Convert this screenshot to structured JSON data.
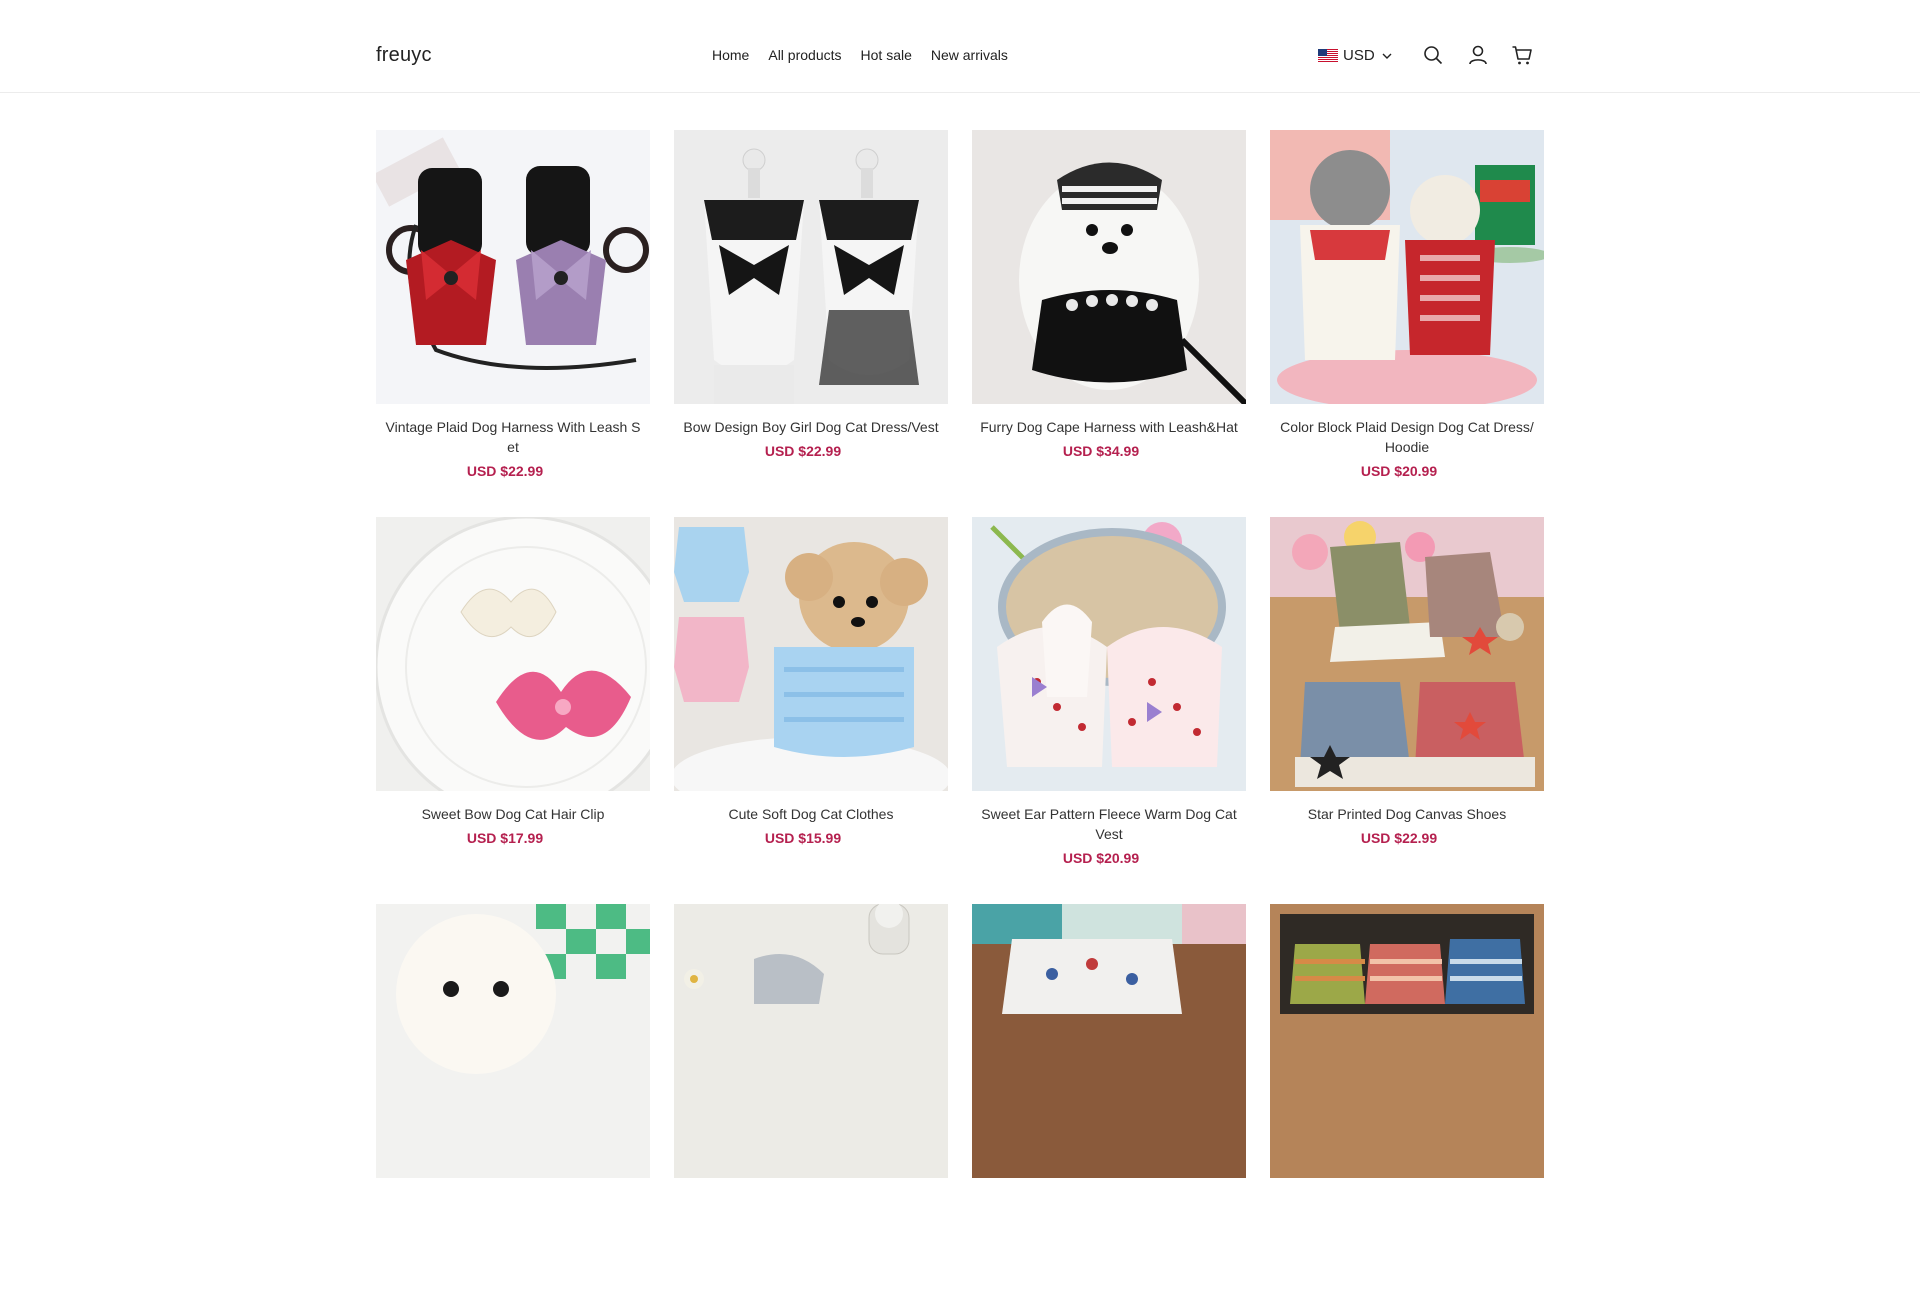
{
  "header": {
    "logo": "freuyc",
    "nav": [
      "Home",
      "All products",
      "Hot sale",
      "New arrivals"
    ],
    "currency": "USD",
    "icons": [
      "search-icon",
      "account-icon",
      "cart-icon"
    ]
  },
  "colors": {
    "price": "#b5204f",
    "border": "#ececec"
  },
  "products": [
    {
      "title": "Vintage Plaid Dog Harness With Leash Set",
      "price": "USD $22.99",
      "image": "red-and-purple-plaid-harness"
    },
    {
      "title": "Bow Design Boy Girl Dog Cat Dress/Vest",
      "price": "USD $22.99",
      "image": "black-white-bow-dresses"
    },
    {
      "title": "Furry Dog Cape Harness with Leash&Hat",
      "price": "USD $34.99",
      "image": "white-dog-in-black-cape"
    },
    {
      "title": "Color Block Plaid Design Dog Cat Dress/Hoodie",
      "price": "USD $20.99",
      "image": "red-plaid-hoodies"
    },
    {
      "title": "Sweet Bow Dog Cat Hair Clip",
      "price": "USD $17.99",
      "image": "cream-and-pink-hair-bows"
    },
    {
      "title": "Cute Soft Dog Cat Clothes",
      "price": "USD $15.99",
      "image": "poodle-in-blue-sweater"
    },
    {
      "title": "Sweet Ear Pattern Fleece Warm Dog Cat Vest",
      "price": "USD $20.99",
      "image": "cherry-print-fleece-vests"
    },
    {
      "title": "Star Printed Dog Canvas Shoes",
      "price": "USD $22.99",
      "image": "denim-star-canvas-shoes"
    },
    {
      "title": "",
      "price": "",
      "image": "white-dog-green-check"
    },
    {
      "title": "",
      "price": "",
      "image": "flowers-and-clothes"
    },
    {
      "title": "",
      "price": "",
      "image": "printed-clothes"
    },
    {
      "title": "",
      "price": "",
      "image": "striped-sweaters"
    }
  ]
}
